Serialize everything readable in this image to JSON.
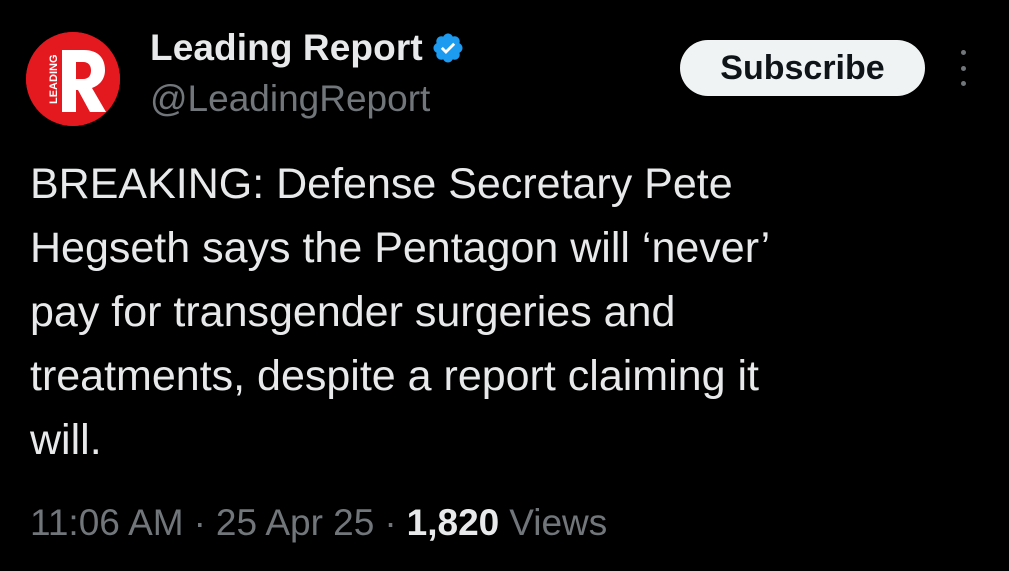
{
  "account": {
    "display_name": "Leading Report",
    "handle": "@LeadingReport",
    "avatar_text": "LEADING",
    "avatar_letter": "R",
    "verified": true
  },
  "actions": {
    "subscribe_label": "Subscribe",
    "more_icon": "more-vertical-icon"
  },
  "tweet": {
    "text": "BREAKING: Defense Secretary Pete\nHegseth says the Pentagon will ‘never’\npay for transgender surgeries and\ntreatments, despite a report claiming it\nwill.",
    "time": "11:06 AM",
    "separator": "·",
    "date": "25 Apr 25",
    "views_count": "1,820",
    "views_label": "Views"
  },
  "colors": {
    "background": "#000000",
    "text_primary": "#e7e9ea",
    "text_secondary": "#71767b",
    "verified_blue": "#1d9bf0",
    "avatar_red": "#e4181f",
    "subscribe_bg": "#eff3f4"
  }
}
